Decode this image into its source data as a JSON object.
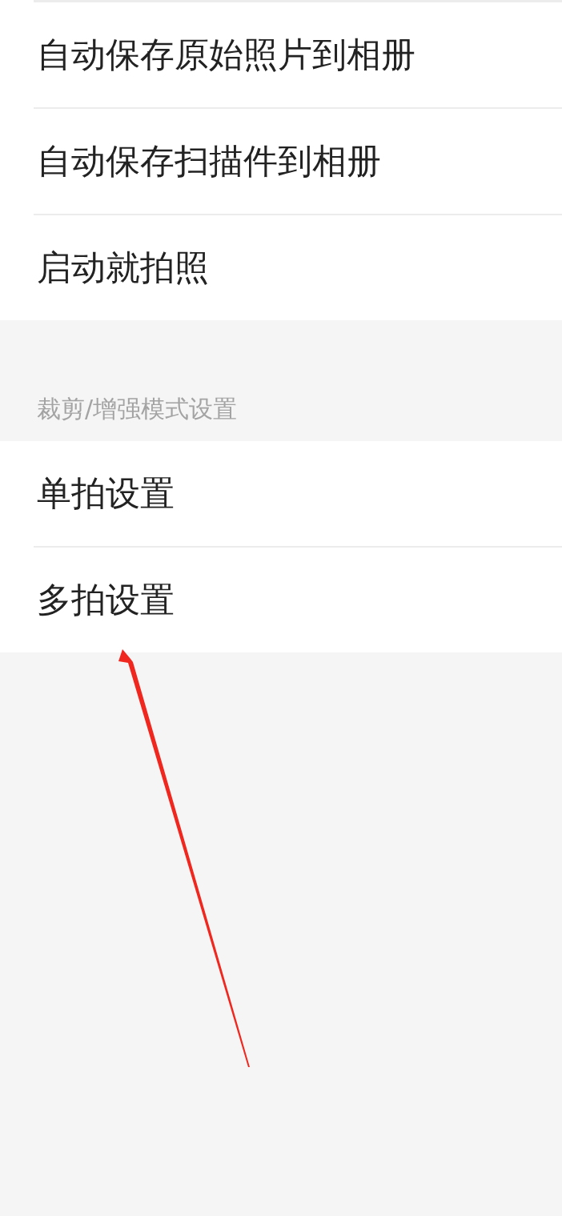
{
  "sections": [
    {
      "items": [
        {
          "label": "自动保存原始照片到相册"
        },
        {
          "label": "自动保存扫描件到相册"
        },
        {
          "label": "启动就拍照"
        }
      ]
    },
    {
      "header": "裁剪/增强模式设置",
      "items": [
        {
          "label": "单拍设置"
        },
        {
          "label": "多拍设置"
        }
      ]
    }
  ]
}
